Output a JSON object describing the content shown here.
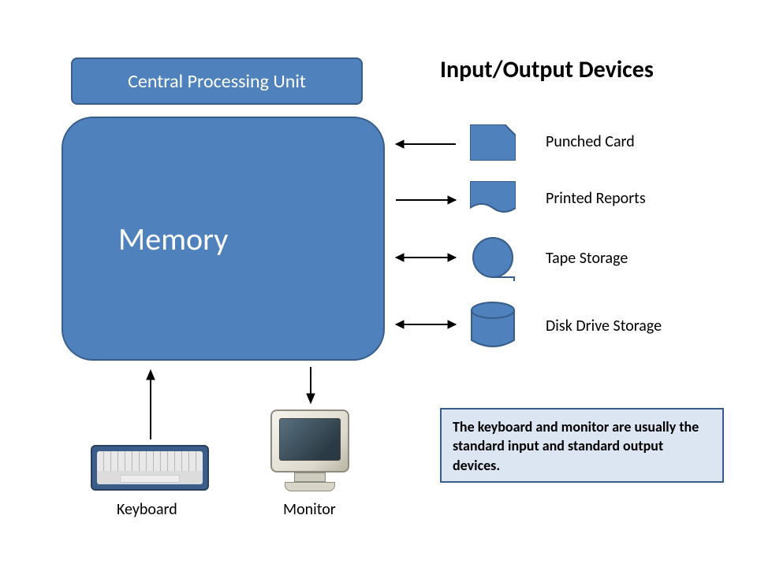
{
  "cpu_label": "Central Processing Unit",
  "memory_label": "Memory",
  "io_heading": "Input/Output Devices",
  "devices": {
    "punched_card": "Punched Card",
    "printed_reports": "Printed Reports",
    "tape_storage": "Tape Storage",
    "disk_storage": "Disk Drive Storage"
  },
  "peripherals": {
    "keyboard": "Keyboard",
    "monitor": "Monitor"
  },
  "note_text": "The keyboard and monitor are usually the standard input and standard output devices.",
  "colors": {
    "block_fill": "#4f81bd",
    "block_border": "#385d8a",
    "note_bg": "#dce6f2"
  }
}
